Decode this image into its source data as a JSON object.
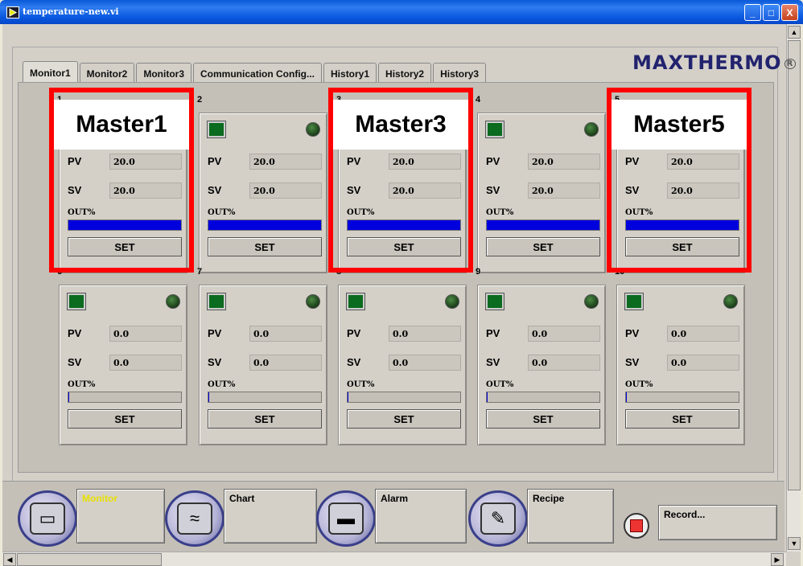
{
  "window": {
    "title": "temperature-new.vi",
    "min_glyph": "_",
    "max_glyph": "□",
    "close_glyph": "X"
  },
  "scroll": {
    "up": "▲",
    "down": "▼",
    "left": "◀",
    "right": "▶"
  },
  "tabs": [
    {
      "label": "Monitor1",
      "active": true
    },
    {
      "label": "Monitor2",
      "active": false
    },
    {
      "label": "Monitor3",
      "active": false
    },
    {
      "label": "Communication Config...",
      "active": false
    },
    {
      "label": "History1",
      "active": false
    },
    {
      "label": "History2",
      "active": false
    },
    {
      "label": "History3",
      "active": false
    }
  ],
  "logo": {
    "text": "MAXTHERMO",
    "mark": "R"
  },
  "labels": {
    "pv": "PV",
    "sv": "SV",
    "out": "OUT%",
    "set": "SET"
  },
  "devices": [
    {
      "id": "1",
      "pv": "20.0",
      "sv": "20.0",
      "out_fraction": 1.0
    },
    {
      "id": "2",
      "pv": "20.0",
      "sv": "20.0",
      "out_fraction": 1.0
    },
    {
      "id": "3",
      "pv": "20.0",
      "sv": "20.0",
      "out_fraction": 1.0
    },
    {
      "id": "4",
      "pv": "20.0",
      "sv": "20.0",
      "out_fraction": 1.0
    },
    {
      "id": "5",
      "pv": "20.0",
      "sv": "20.0",
      "out_fraction": 1.0
    },
    {
      "id": "6",
      "pv": "0.0",
      "sv": "0.0",
      "out_fraction": 0.0
    },
    {
      "id": "7",
      "pv": "0.0",
      "sv": "0.0",
      "out_fraction": 0.0
    },
    {
      "id": "8",
      "pv": "0.0",
      "sv": "0.0",
      "out_fraction": 0.0
    },
    {
      "id": "9",
      "pv": "0.0",
      "sv": "0.0",
      "out_fraction": 0.0
    },
    {
      "id": "10",
      "pv": "0.0",
      "sv": "0.0",
      "out_fraction": 0.0
    }
  ],
  "masters": [
    "Master1",
    "Master3",
    "Master5"
  ],
  "nav": [
    {
      "label": "Monitor",
      "icon": "monitor-icon",
      "active": true
    },
    {
      "label": "Chart",
      "icon": "chart-icon",
      "active": false
    },
    {
      "label": "Alarm",
      "icon": "alarm-icon",
      "active": false
    },
    {
      "label": "Recipe",
      "icon": "recipe-icon",
      "active": false
    }
  ],
  "record": {
    "label": "Record..."
  },
  "colors": {
    "led_green": "#0b6b1e",
    "out_bar": "#0000dd",
    "highlight": "#ff0000",
    "active_nav_text": "#e8e000"
  }
}
